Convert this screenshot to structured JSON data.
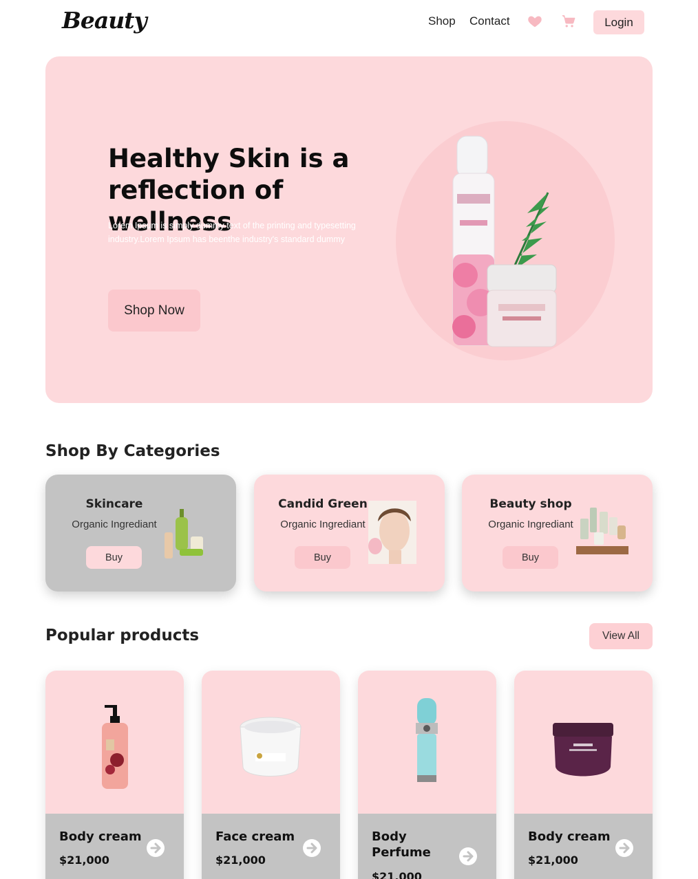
{
  "nav": {
    "logo": "Beauty",
    "links": [
      "Shop",
      "Contact"
    ],
    "login": "Login",
    "icons": [
      "heart-icon",
      "cart-icon"
    ]
  },
  "hero": {
    "title": "Healthy Skin is a reflection of wellness",
    "subtitle": "Lorem Ipsum is simply dummy text of the printing and typesetting industry.Lorem Ipsum has beenthe industry's standard dummy",
    "cta": "Shop Now"
  },
  "categories": {
    "title": "Shop By Categories",
    "items": [
      {
        "name": "Skincare",
        "desc": "Organic Ingrediant",
        "buy": "Buy"
      },
      {
        "name": "Candid Green",
        "desc": "Organic Ingrediant",
        "buy": "Buy"
      },
      {
        "name": "Beauty shop",
        "desc": "Organic Ingrediant",
        "buy": "Buy"
      }
    ]
  },
  "popular": {
    "title": "Popular products",
    "view_all": "View All",
    "items": [
      {
        "name": "Body cream",
        "price": "$21,000"
      },
      {
        "name": "Face cream",
        "price": "$21,000"
      },
      {
        "name": "Body Perfume",
        "price": "$21,000"
      },
      {
        "name": "Body cream",
        "price": "$21,000"
      }
    ]
  },
  "colors": {
    "pink": "#fdd9dc",
    "pink_dark": "#fbc8cd",
    "gray": "#c3c3c3"
  }
}
